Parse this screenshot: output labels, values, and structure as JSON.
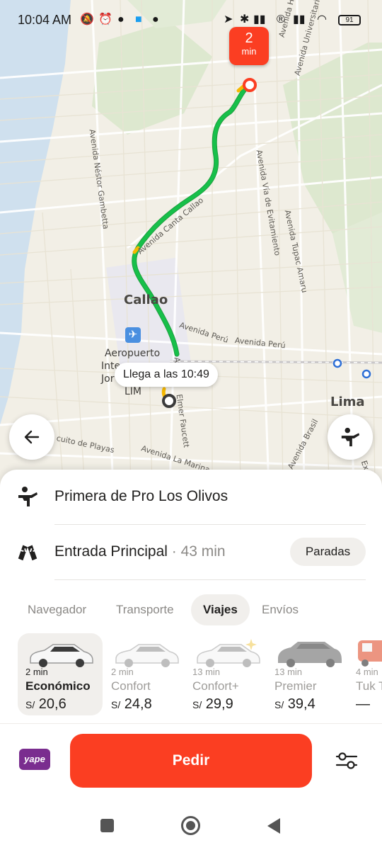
{
  "status_bar": {
    "time": "10:04 AM",
    "battery": "91"
  },
  "map": {
    "eta_pin": {
      "value": "2",
      "unit": "min"
    },
    "arrival_bubble": "Llega a las 10:49",
    "labels": {
      "city_callao": "Callao",
      "city_lima": "Lima",
      "airport_line1": "Aeropuerto",
      "airport_line2": "Inte",
      "airport_line3": "Jor",
      "airport_code": "LIM",
      "street_nestor": "Avenida Néstor Gambetta",
      "street_canta": "Avenida Canta Callao",
      "street_evitamiento": "Avenida Vía de Evitamiento",
      "street_tupac": "Avenida Tupac Amaru",
      "street_peru_1": "Avenida Perú",
      "street_peru_2": "Avenida Perú",
      "street_faucett_1": "Ave",
      "street_faucett_2": "Elmer Faucett",
      "street_playas": "cuito de Playas",
      "street_marina": "Avenida La Marina",
      "street_brasil": "Avenida Brasil",
      "street_universitaria": "Avenida Universitaria",
      "street_heroes": "Avenida Héroes",
      "street_expr": "Expr"
    }
  },
  "route": {
    "pickup": "Primera de Pro Los Olivos",
    "destination": "Entrada Principal",
    "destination_duration": " · 43 min",
    "stops_label": "Paradas"
  },
  "tabs": [
    {
      "label": "Navegador"
    },
    {
      "label": "Transporte"
    },
    {
      "label": "Viajes"
    },
    {
      "label": "Envíos"
    }
  ],
  "tariffs": [
    {
      "eta": "2 min",
      "name": "Económico",
      "currency": "S/",
      "price": "20,6"
    },
    {
      "eta": "2 min",
      "name": "Confort",
      "currency": "S/",
      "price": "24,8"
    },
    {
      "eta": "13 min",
      "name": "Confort+",
      "currency": "S/",
      "price": "29,9"
    },
    {
      "eta": "13 min",
      "name": "Premier",
      "currency": "S/",
      "price": "39,4"
    },
    {
      "eta": "4 min",
      "name": "Tuk Tuk",
      "currency": "",
      "price": "—"
    }
  ],
  "bottom_bar": {
    "payment_logo_text": "yape",
    "order_label": "Pedir"
  },
  "colors": {
    "accent": "#fb3e22",
    "route": "#17c04a",
    "route_traffic": "#f5b800",
    "map_bg": "#f2efe6",
    "water": "#cfe0ee",
    "park": "#dde8cf",
    "sheet_chip": "#f1efec"
  },
  "icons": {
    "back": "arrow-left-icon",
    "person": "person-waving-icon",
    "checkered_flag": "checkered-flags-icon",
    "settings": "sliders-icon",
    "airport": "airplane-icon"
  }
}
